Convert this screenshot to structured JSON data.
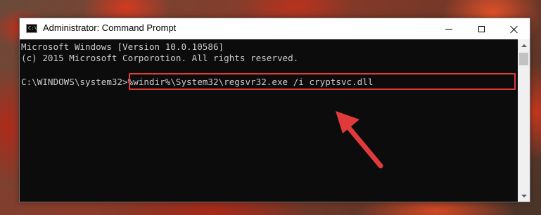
{
  "window": {
    "title": "Administrator: Command Prompt",
    "icon": "cmd-icon"
  },
  "titlebar_controls": [
    "minimize-icon",
    "maximize-icon",
    "close-icon"
  ],
  "console": {
    "lines": [
      "Microsoft Windows [Version 10.0.10586]",
      "(c) 2015 Microsoft Corporotion. All rights reserved.",
      ""
    ],
    "prompt": "C:\\WINDOWS\\system32>",
    "command": "%windir%\\System32\\regsvr32.exe /i cryptsvc.dll"
  },
  "highlight": {
    "target": "command",
    "color": "#e03a3a"
  },
  "annotation": {
    "icon": "arrow-icon",
    "color": "#e03a3a"
  },
  "colors": {
    "console_bg": "#0c0c0c",
    "console_text": "#cccccc"
  }
}
